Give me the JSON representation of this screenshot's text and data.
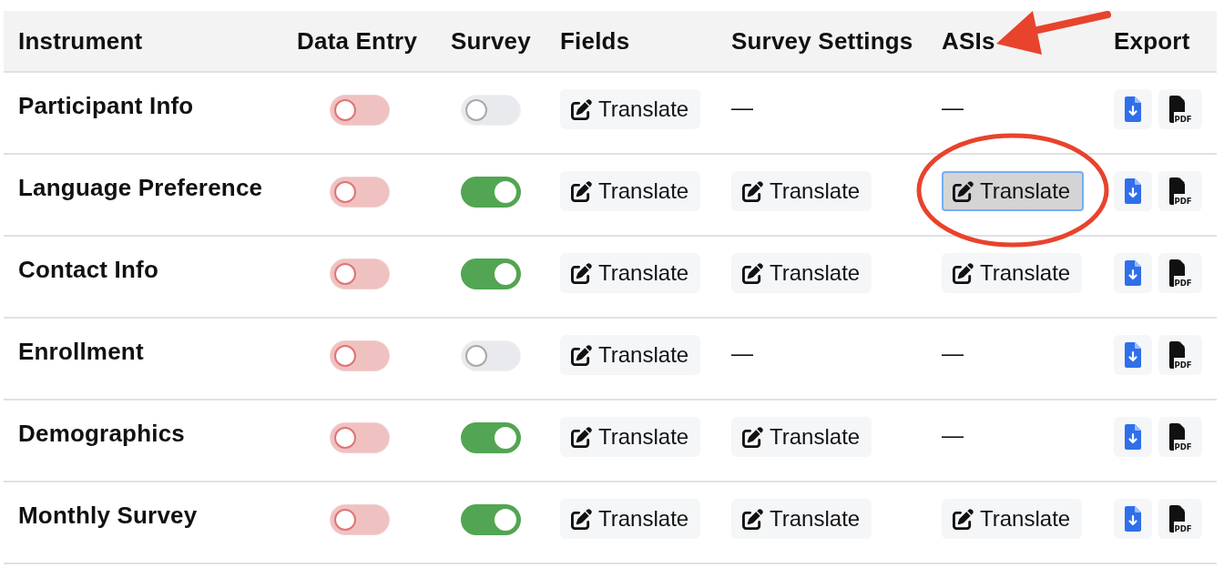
{
  "columns": [
    {
      "label": "Instrument",
      "arrow": false
    },
    {
      "label": "Data Entry",
      "arrow": false
    },
    {
      "label": "Survey",
      "arrow": false
    },
    {
      "label": "Fields",
      "arrow": false
    },
    {
      "label": "Survey Settings",
      "arrow": false
    },
    {
      "label": "ASIs",
      "arrow": true
    },
    {
      "label": "Export",
      "arrow": false
    }
  ],
  "rows": [
    {
      "name": "Participant Info",
      "data_entry": {
        "kind": "danger",
        "on": false
      },
      "survey": {
        "kind": "standard",
        "on": false
      },
      "fields": {
        "kind": "button",
        "label": "Translate",
        "focused": false,
        "circled": false
      },
      "survey_settings": {
        "kind": "dash",
        "text": "—"
      },
      "asis": {
        "kind": "dash",
        "text": "—"
      },
      "export": {
        "pdf_label": "PDF"
      }
    },
    {
      "name": "Language Preference",
      "data_entry": {
        "kind": "danger",
        "on": false
      },
      "survey": {
        "kind": "standard",
        "on": true
      },
      "fields": {
        "kind": "button",
        "label": "Translate",
        "focused": false,
        "circled": false
      },
      "survey_settings": {
        "kind": "button",
        "label": "Translate",
        "focused": false,
        "circled": false
      },
      "asis": {
        "kind": "button",
        "label": "Translate",
        "focused": true,
        "circled": true
      },
      "export": {
        "pdf_label": "PDF"
      }
    },
    {
      "name": "Contact Info",
      "data_entry": {
        "kind": "danger",
        "on": false
      },
      "survey": {
        "kind": "standard",
        "on": true
      },
      "fields": {
        "kind": "button",
        "label": "Translate",
        "focused": false,
        "circled": false
      },
      "survey_settings": {
        "kind": "button",
        "label": "Translate",
        "focused": false,
        "circled": false
      },
      "asis": {
        "kind": "button",
        "label": "Translate",
        "focused": false,
        "circled": false
      },
      "export": {
        "pdf_label": "PDF"
      }
    },
    {
      "name": "Enrollment",
      "data_entry": {
        "kind": "danger",
        "on": false
      },
      "survey": {
        "kind": "standard",
        "on": false
      },
      "fields": {
        "kind": "button",
        "label": "Translate",
        "focused": false,
        "circled": false
      },
      "survey_settings": {
        "kind": "dash",
        "text": "—"
      },
      "asis": {
        "kind": "dash",
        "text": "—"
      },
      "export": {
        "pdf_label": "PDF"
      }
    },
    {
      "name": "Demographics",
      "data_entry": {
        "kind": "danger",
        "on": false
      },
      "survey": {
        "kind": "standard",
        "on": true
      },
      "fields": {
        "kind": "button",
        "label": "Translate",
        "focused": false,
        "circled": false
      },
      "survey_settings": {
        "kind": "button",
        "label": "Translate",
        "focused": false,
        "circled": false
      },
      "asis": {
        "kind": "dash",
        "text": "—"
      },
      "export": {
        "pdf_label": "PDF"
      }
    },
    {
      "name": "Monthly Survey",
      "data_entry": {
        "kind": "danger",
        "on": false
      },
      "survey": {
        "kind": "standard",
        "on": true
      },
      "fields": {
        "kind": "button",
        "label": "Translate",
        "focused": false,
        "circled": false
      },
      "survey_settings": {
        "kind": "button",
        "label": "Translate",
        "focused": false,
        "circled": false
      },
      "asis": {
        "kind": "button",
        "label": "Translate",
        "focused": false,
        "circled": false
      },
      "export": {
        "pdf_label": "PDF"
      }
    }
  ]
}
